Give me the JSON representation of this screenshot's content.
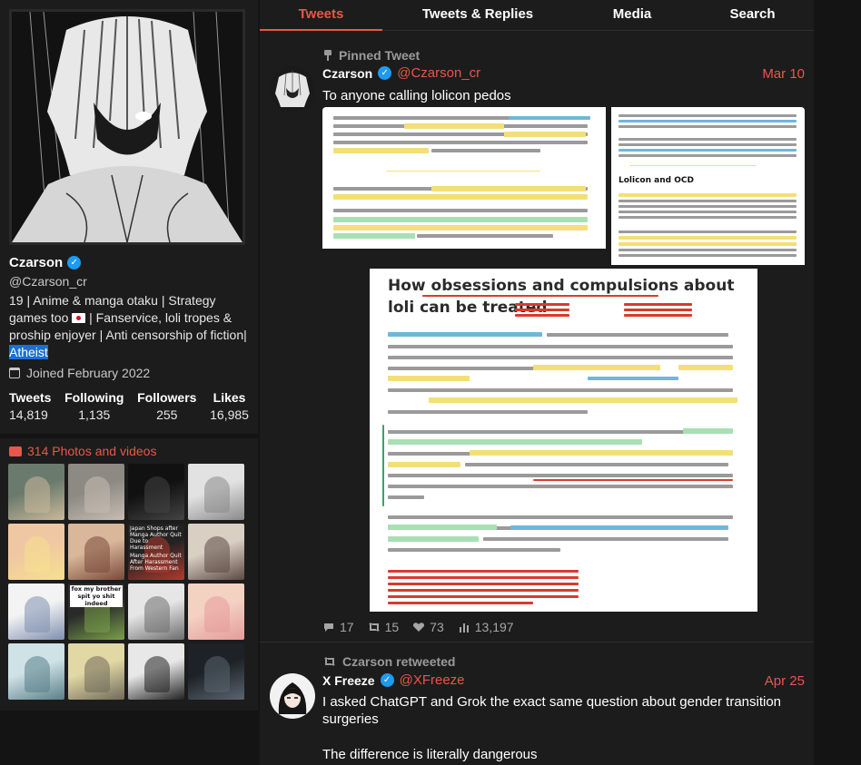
{
  "profile": {
    "name": "Czarson",
    "handle": "@Czarson_cr",
    "bio_part1": "19 | Anime & manga otaku | Strategy games too ",
    "bio_part2": " | Fanservice, loli tropes & proship enjoyer | Anti censorship of fiction| ",
    "bio_selected": "Atheist",
    "joined": "Joined February 2022",
    "stats": [
      {
        "label": "Tweets",
        "value": "14,819"
      },
      {
        "label": "Following",
        "value": "1,135"
      },
      {
        "label": "Followers",
        "value": "255"
      },
      {
        "label": "Likes",
        "value": "16,985"
      }
    ]
  },
  "media": {
    "title": "314 Photos and videos",
    "thumbs": [
      {
        "bg": "#6a7b6d",
        "fg": "#c9b89a"
      },
      {
        "bg": "#8d8a84",
        "fg": "#c6bdb2"
      },
      {
        "bg": "#111111",
        "fg": "#444444"
      },
      {
        "bg": "#e2e2e2",
        "fg": "#8a8a8a"
      },
      {
        "bg": "#f0c7a3",
        "fg": "#f6e08f"
      },
      {
        "bg": "#d8b79a",
        "fg": "#7a4a3a"
      },
      {
        "bg": "#222222",
        "fg": "#b03a2e"
      },
      {
        "bg": "#d9cfc3",
        "fg": "#5d4a44"
      },
      {
        "bg": "#f3f3f3",
        "fg": "#7f8fb0"
      },
      {
        "bg": "#2a2a2a",
        "fg": "#7aa04a"
      },
      {
        "bg": "#e6e6e6",
        "fg": "#6d6d6d"
      },
      {
        "bg": "#f4d2c2",
        "fg": "#e59b9b"
      },
      {
        "bg": "#cfe2e6",
        "fg": "#5a7f88"
      },
      {
        "bg": "#e2d8a4",
        "fg": "#6f6a5a"
      },
      {
        "bg": "#e8e8e8",
        "fg": "#222222"
      },
      {
        "bg": "#1e2226",
        "fg": "#5a6470"
      }
    ],
    "thumb_texts": {
      "t7_a": "Japan Shops after Manga Author Quit Due to Harassment",
      "t7_b": "Manga Author Quit After Harassment From Western Fan",
      "t10": "fox my brother spit yo shit indeed"
    }
  },
  "tabs": [
    {
      "label": "Tweets",
      "active": true
    },
    {
      "label": "Tweets & Replies",
      "active": false
    },
    {
      "label": "Media",
      "active": false
    },
    {
      "label": "Search",
      "active": false
    }
  ],
  "tweet1": {
    "pinned_label": "Pinned Tweet",
    "name": "Czarson",
    "handle": "@Czarson_cr",
    "date": "Mar 10",
    "text": "To anyone calling lolicon pedos",
    "image_c_title": "How obsessions and compulsions about loli can be treated",
    "image_b_heading": "Lolicon and OCD",
    "replies": "17",
    "retweets": "15",
    "likes": "73",
    "views": "13,197"
  },
  "tweet2": {
    "retweeted_label": "Czarson retweeted",
    "name": "X Freeze",
    "handle": "@XFreeze",
    "date": "Apr 25",
    "text": "I asked ChatGPT and Grok the exact same question about gender transition surgeries",
    "text2": "The difference is literally dangerous"
  },
  "colors": {
    "accent": "#e8574a",
    "verified": "#1d9bf0",
    "panel": "#1c1c1c",
    "background": "#141414"
  }
}
